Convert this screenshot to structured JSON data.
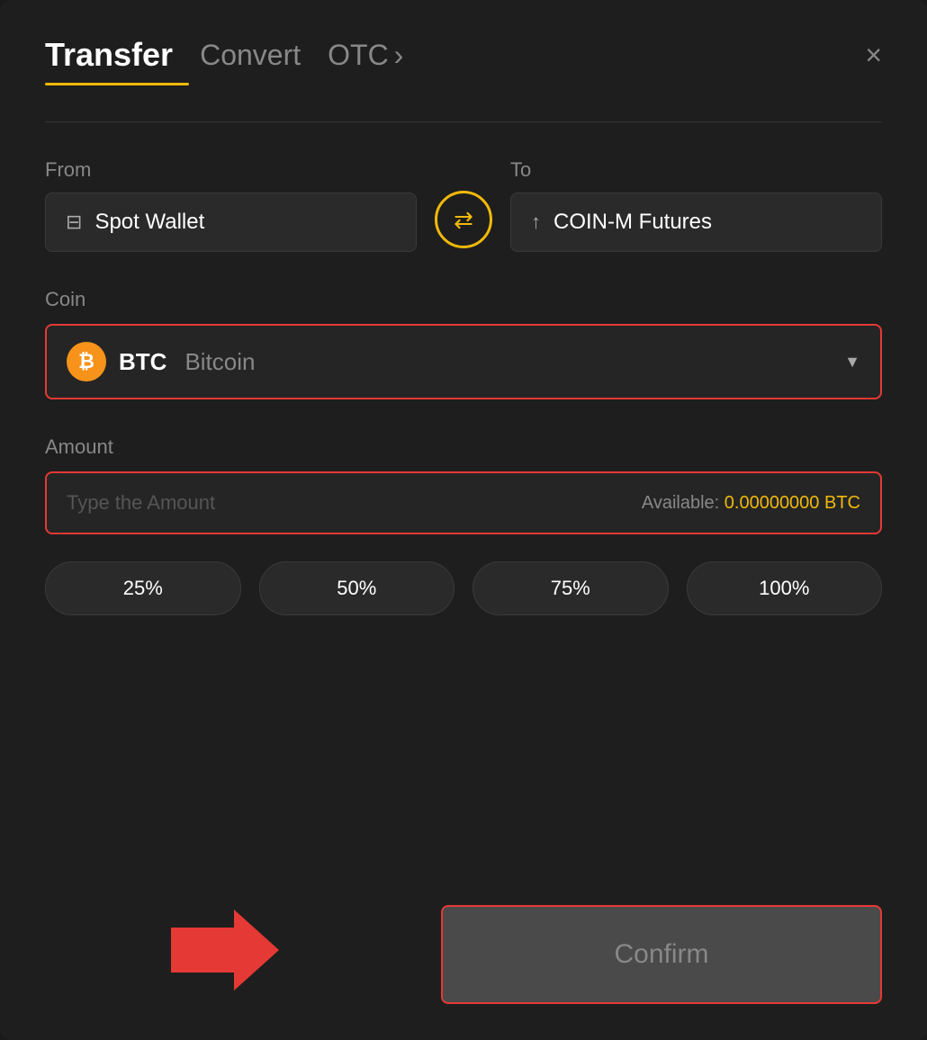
{
  "header": {
    "transfer_label": "Transfer",
    "convert_label": "Convert",
    "otc_label": "OTC",
    "otc_arrow": "›",
    "close_label": "×"
  },
  "from_section": {
    "label": "From",
    "wallet_name": "Spot Wallet"
  },
  "to_section": {
    "label": "To",
    "wallet_name": "COIN-M Futures"
  },
  "coin_section": {
    "label": "Coin",
    "coin_symbol": "BTC",
    "coin_full": "Bitcoin",
    "btc_icon_label": "₿"
  },
  "amount_section": {
    "label": "Amount",
    "placeholder": "Type the Amount",
    "available_label": "Available:",
    "available_value": "0.00000000 BTC"
  },
  "percentage_buttons": [
    {
      "label": "25%"
    },
    {
      "label": "50%"
    },
    {
      "label": "75%"
    },
    {
      "label": "100%"
    }
  ],
  "confirm_button": {
    "label": "Confirm"
  },
  "colors": {
    "accent": "#f0b90b",
    "danger": "#e53935",
    "bg": "#1e1e1e",
    "text_muted": "#888888"
  }
}
